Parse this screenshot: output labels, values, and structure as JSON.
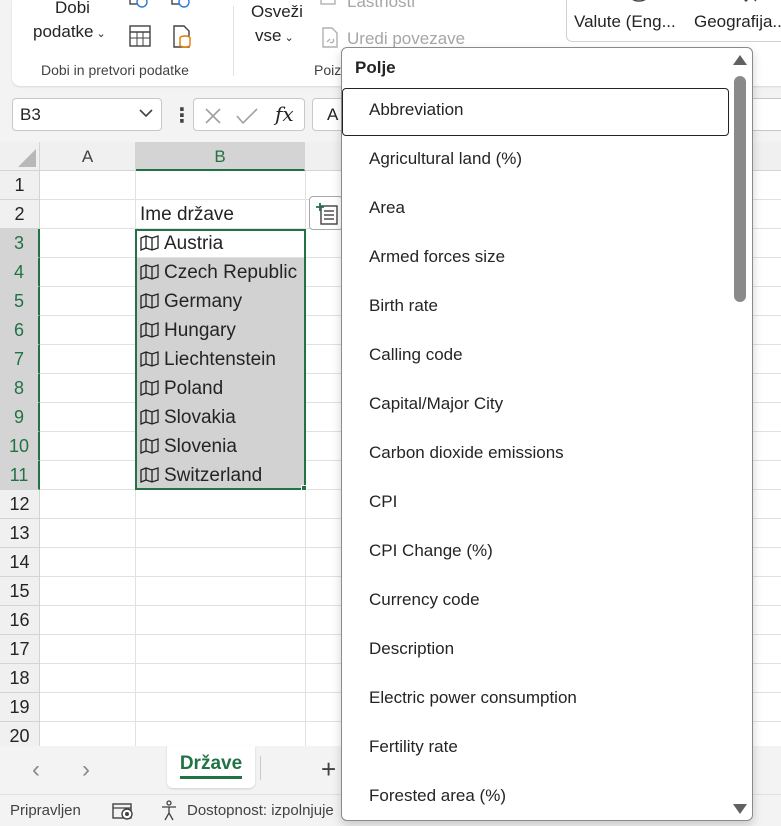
{
  "ribbon": {
    "get_data_label_line1": "Dobi",
    "get_data_label_line2": "podatke",
    "group_get_transform": "Dobi in pretvori podatke",
    "refresh_label_line1": "Osveži",
    "refresh_label_line2": "vse",
    "properties_label": "Lastnosti",
    "edit_links_label": "Uredi povezave",
    "group_queries_partial": "Poiz",
    "datatype_currencies": "Valute (Eng...",
    "datatype_geography": "Geografija..."
  },
  "formula_bar": {
    "name_box": "B3",
    "content_partial": "A"
  },
  "sheet": {
    "columns": [
      "A",
      "B"
    ],
    "rows": [
      "1",
      "2",
      "3",
      "4",
      "5",
      "6",
      "7",
      "8",
      "9",
      "10",
      "11",
      "12",
      "13",
      "14",
      "15",
      "16",
      "17",
      "18",
      "19",
      "20"
    ],
    "header_cell": "Ime države",
    "countries": [
      "Austria",
      "Czech Republic",
      "Germany",
      "Hungary",
      "Liechtenstein",
      "Poland",
      "Slovakia",
      "Slovenia",
      "Switzerland"
    ]
  },
  "tabs": {
    "active_sheet": "Države",
    "add_sheet": "+"
  },
  "status": {
    "ready": "Pripravljen",
    "accessibility": "Dostopnost: izpolnjuje"
  },
  "dropdown": {
    "header": "Polje",
    "items": [
      "Abbreviation",
      "Agricultural land (%)",
      "Area",
      "Armed forces size",
      "Birth rate",
      "Calling code",
      "Capital/Major City",
      "Carbon dioxide emissions",
      "CPI",
      "CPI Change (%)",
      "Currency code",
      "Description",
      "Electric power consumption",
      "Fertility rate",
      "Forested area (%)"
    ]
  },
  "colors": {
    "accent": "#217346",
    "selection_fill": "#d2d2d2"
  }
}
